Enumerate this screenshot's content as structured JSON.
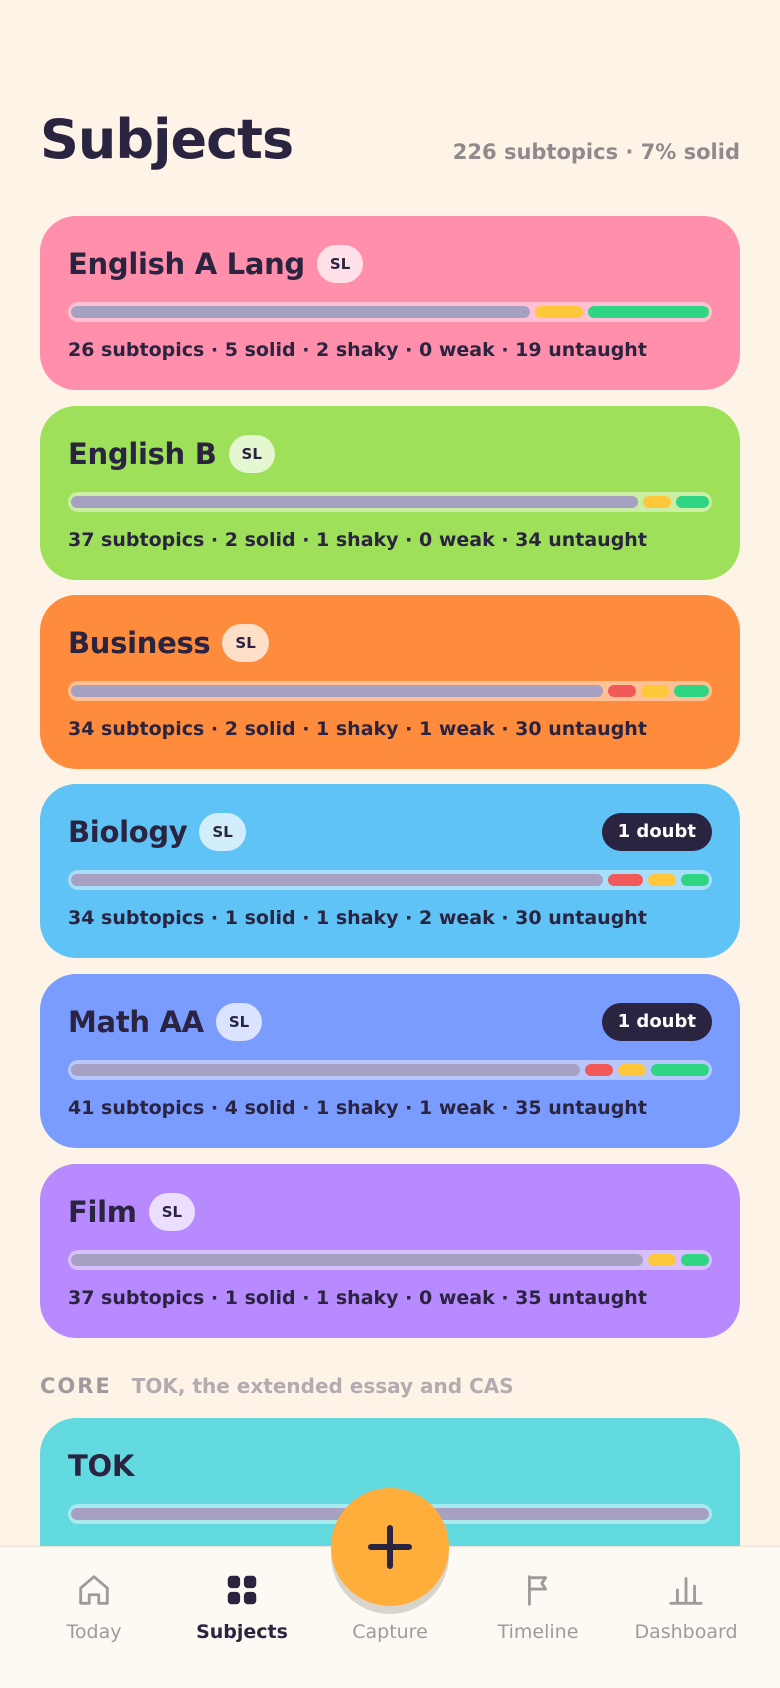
{
  "header": {
    "title": "Subjects",
    "summary": "226 subtopics · 7% solid"
  },
  "colors": {
    "untaught": "#a6a0c2",
    "weak": "#f25a5a",
    "shaky": "#ffc83a",
    "solid": "#2ed583",
    "english_a": "#ff8fab",
    "english_b": "#9ee05a",
    "business": "#ff8c3c",
    "biology": "#5fc3f5",
    "math_aa": "#7b9cff",
    "film": "#b88aff",
    "tok": "#62dae0",
    "fab": "#ffad3b"
  },
  "subjects": [
    {
      "name": "English A Lang",
      "level": "SL",
      "stats": "26 subtopics · 5 solid · 2 shaky · 0 weak · 19 untaught",
      "progress": {
        "untaught": 19,
        "weak": 0,
        "shaky": 2,
        "solid": 5
      }
    },
    {
      "name": "English B",
      "level": "SL",
      "stats": "37 subtopics · 2 solid · 1 shaky · 0 weak · 34 untaught",
      "progress": {
        "untaught": 34,
        "weak": 0,
        "shaky": 1,
        "solid": 2
      }
    },
    {
      "name": "Business",
      "level": "SL",
      "stats": "34 subtopics · 2 solid · 1 shaky · 1 weak · 30 untaught",
      "progress": {
        "untaught": 30,
        "weak": 1,
        "shaky": 1,
        "solid": 2
      }
    },
    {
      "name": "Biology",
      "level": "SL",
      "doubt": "1 doubt",
      "stats": "34 subtopics · 1 solid · 1 shaky · 2 weak · 30 untaught",
      "progress": {
        "untaught": 30,
        "weak": 2,
        "shaky": 1,
        "solid": 1
      }
    },
    {
      "name": "Math AA",
      "level": "SL",
      "doubt": "1 doubt",
      "stats": "41 subtopics · 4 solid · 1 shaky · 1 weak · 35 untaught",
      "progress": {
        "untaught": 35,
        "weak": 1,
        "shaky": 1,
        "solid": 4
      }
    },
    {
      "name": "Film",
      "level": "SL",
      "stats": "37 subtopics · 1 solid · 1 shaky · 0 weak · 35 untaught",
      "progress": {
        "untaught": 35,
        "weak": 0,
        "shaky": 1,
        "solid": 1
      }
    }
  ],
  "core": {
    "title": "CORE",
    "description": "TOK, the extended essay and CAS"
  },
  "tok": {
    "name": "TOK",
    "progress": {
      "untaught": 1,
      "weak": 0,
      "shaky": 0,
      "solid": 0
    }
  },
  "nav": {
    "tabs": [
      {
        "label": "Today",
        "icon": "home-icon"
      },
      {
        "label": "Subjects",
        "icon": "grid-icon",
        "active": true
      },
      {
        "label": "Capture",
        "icon": "plus-icon"
      },
      {
        "label": "Timeline",
        "icon": "flag-icon"
      },
      {
        "label": "Dashboard",
        "icon": "bar-chart-icon"
      }
    ]
  }
}
